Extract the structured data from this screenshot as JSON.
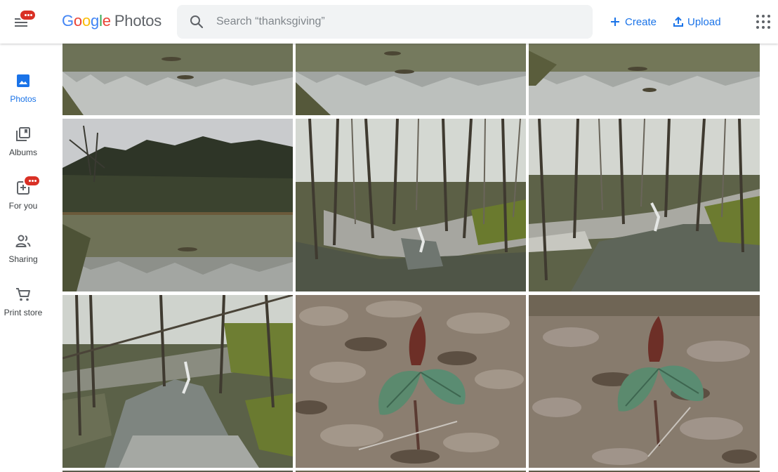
{
  "header": {
    "logo_google": [
      "G",
      "o",
      "o",
      "g",
      "l",
      "e"
    ],
    "logo_product": "Photos",
    "search_placeholder": "Search “thanksgiving”",
    "create_label": "Create",
    "upload_label": "Upload"
  },
  "sidebar": {
    "items": [
      {
        "label": "Photos",
        "icon": "photo-icon",
        "active": true
      },
      {
        "label": "Albums",
        "icon": "albums-icon",
        "active": false
      },
      {
        "label": "For you",
        "icon": "for-you-icon",
        "active": false
      },
      {
        "label": "Sharing",
        "icon": "people-icon",
        "active": false
      },
      {
        "label": "Print store",
        "icon": "cart-icon",
        "active": false
      }
    ]
  },
  "colors": {
    "accent": "#1a73e8",
    "badge": "#d93025",
    "search_bg": "#f1f3f4"
  },
  "photos": [
    {
      "subject": "lake reflection"
    },
    {
      "subject": "lake reflection"
    },
    {
      "subject": "lake reflection"
    },
    {
      "subject": "lake with trees"
    },
    {
      "subject": "forest creek"
    },
    {
      "subject": "forest creek"
    },
    {
      "subject": "creek flowing"
    },
    {
      "subject": "trillium plant"
    },
    {
      "subject": "trillium plant"
    }
  ]
}
